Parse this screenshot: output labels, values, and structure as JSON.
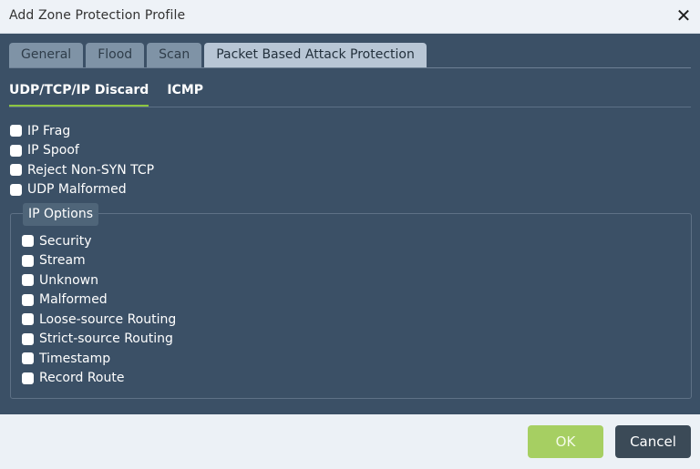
{
  "dialog": {
    "title": "Add Zone Protection Profile",
    "close_symbol": "✕"
  },
  "tabs": [
    {
      "label": "General"
    },
    {
      "label": "Flood"
    },
    {
      "label": "Scan"
    },
    {
      "label": "Packet Based Attack Protection",
      "active": true
    }
  ],
  "subtabs": [
    {
      "label": "UDP/TCP/IP Discard",
      "active": true
    },
    {
      "label": "ICMP"
    }
  ],
  "discard_options": [
    {
      "label": "IP Frag",
      "checked": false
    },
    {
      "label": "IP Spoof",
      "checked": false
    },
    {
      "label": "Reject Non-SYN TCP",
      "checked": false
    },
    {
      "label": "UDP Malformed",
      "checked": false
    }
  ],
  "ip_options": {
    "legend": "IP Options",
    "items": [
      {
        "label": "Security",
        "checked": false
      },
      {
        "label": "Stream",
        "checked": false
      },
      {
        "label": "Unknown",
        "checked": false
      },
      {
        "label": "Malformed",
        "checked": false
      },
      {
        "label": "Loose-source Routing",
        "checked": false
      },
      {
        "label": "Strict-source Routing",
        "checked": false
      },
      {
        "label": "Timestamp",
        "checked": false
      },
      {
        "label": "Record Route",
        "checked": false
      }
    ]
  },
  "footer": {
    "ok_label": "OK",
    "cancel_label": "Cancel"
  },
  "colors": {
    "panel_bg": "#3b5066",
    "accent_green": "#8dc63f",
    "ok_button": "#a6cf62",
    "cancel_button": "#3b4a57"
  }
}
